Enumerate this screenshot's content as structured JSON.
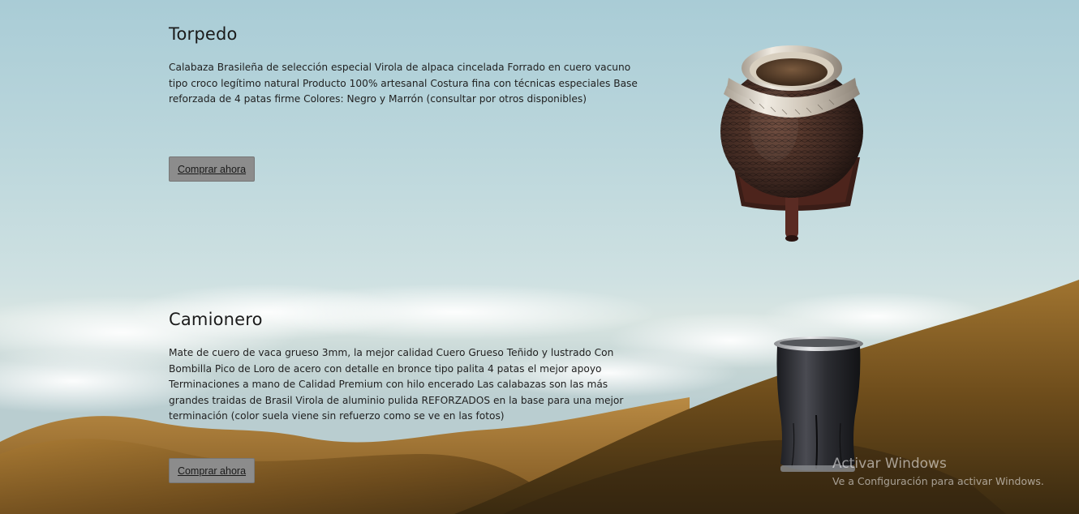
{
  "products": [
    {
      "title": "Torpedo",
      "description": "Calabaza Brasileña de selección especial Virola de alpaca cincelada Forrado en cuero vacuno tipo croco legítimo natural Producto 100% artesanal Costura fina con técnicas especiales Base reforzada de 4 patas firme Colores: Negro y Marrón (consultar por otros disponibles)",
      "button_label": "Comprar ahora"
    },
    {
      "title": "Camionero",
      "description": "Mate de cuero de vaca grueso 3mm, la mejor calidad Cuero Grueso Teñido y lustrado Con Bombilla Pico de Loro de acero con detalle en bronce tipo palita 4 patas el mejor apoyo Terminaciones a mano de Calidad Premium con hilo encerado Las calabazas son las más grandes traidas de Brasil Virola de aluminio pulida REFORZADOS en la base para una mejor terminación (color suela viene sin refuerzo como se ve en las fotos)",
      "button_label": "Comprar ahora"
    }
  ],
  "watermark": {
    "title": "Activar Windows",
    "subtitle": "Ve a Configuración para activar Windows."
  },
  "colors": {
    "button_bg": "#8c8c8c",
    "sky": "#a9ccd6",
    "hills": "#a8742a"
  }
}
